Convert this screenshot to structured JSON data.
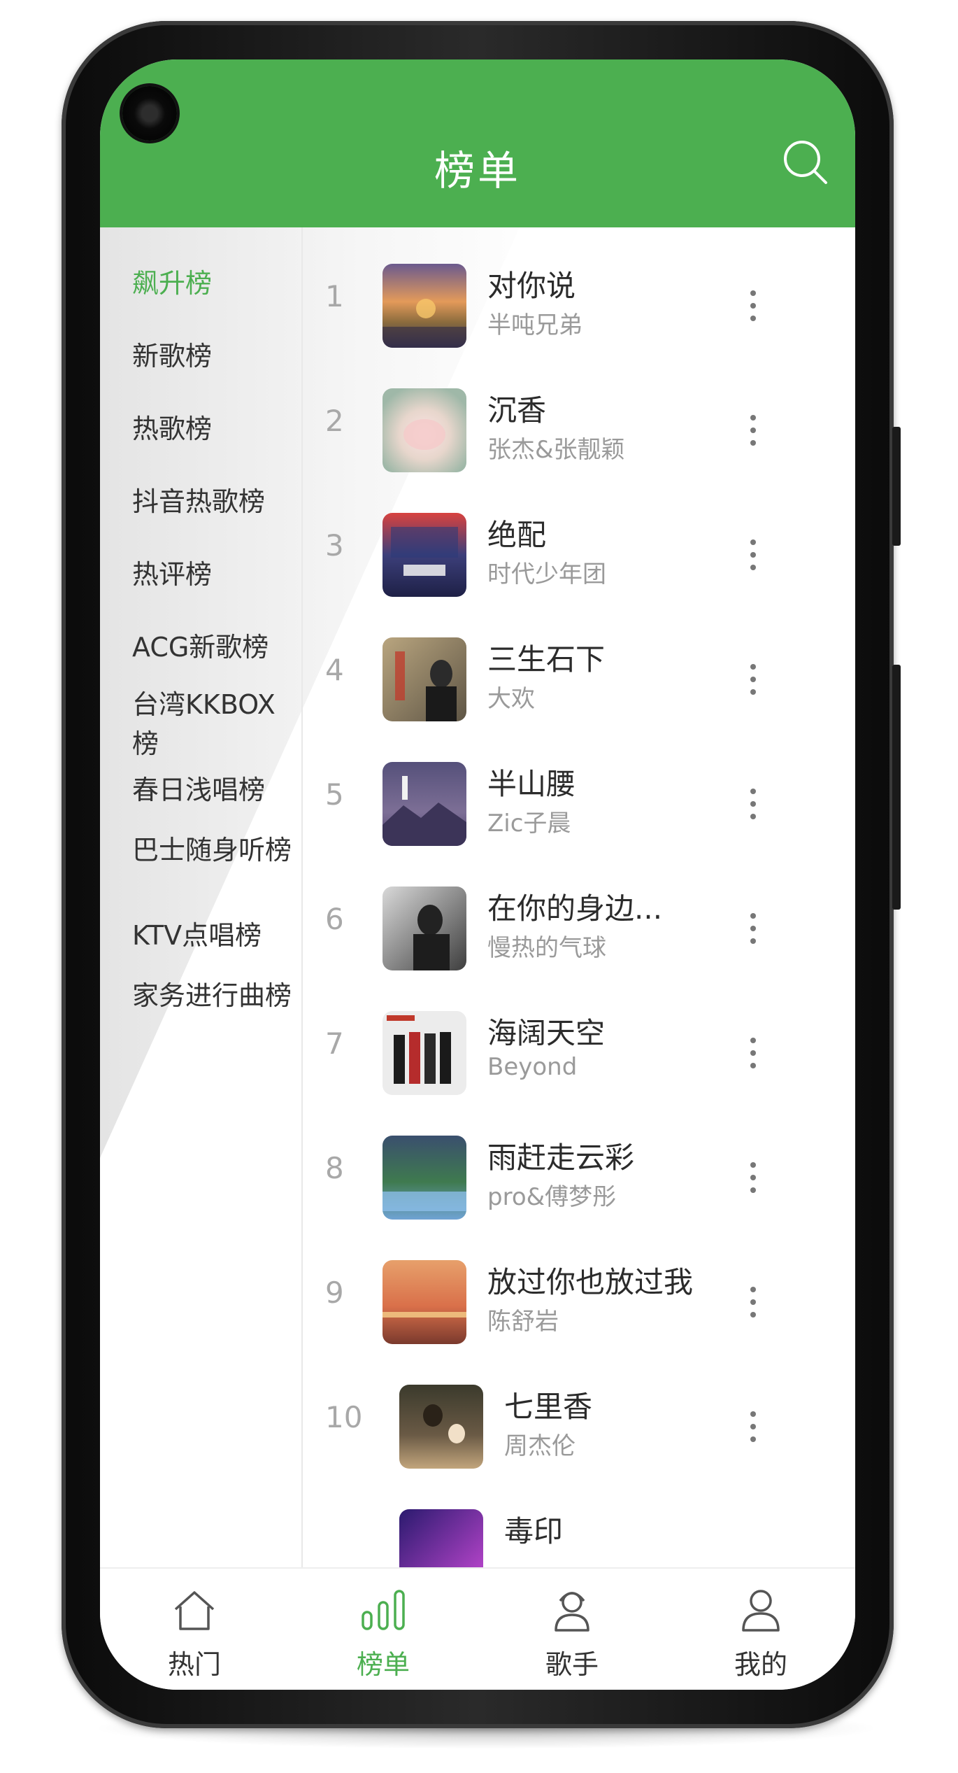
{
  "colors": {
    "accent": "#4CAF50",
    "text_primary": "#2b2b2b",
    "text_secondary": "#9a9a9a"
  },
  "header": {
    "title": "榜单",
    "search_icon": "search-icon"
  },
  "sidebar": {
    "categories": [
      {
        "label": "飙升榜",
        "active": true
      },
      {
        "label": "新歌榜"
      },
      {
        "label": "热歌榜"
      },
      {
        "label": "抖音热歌榜"
      },
      {
        "label": "热评榜"
      },
      {
        "label": "ACG新歌榜"
      },
      {
        "label": "台湾KKBOX榜"
      },
      {
        "label": "春日浅唱榜"
      },
      {
        "label": "巴士随身听榜"
      },
      {
        "label": "KTV点唱榜"
      },
      {
        "label": "家务进行曲榜"
      }
    ]
  },
  "songs": [
    {
      "rank": "1",
      "title": "对你说",
      "artist": "半吨兄弟"
    },
    {
      "rank": "2",
      "title": "沉香",
      "artist": "张杰&张靓颖"
    },
    {
      "rank": "3",
      "title": "绝配",
      "artist": "时代少年团"
    },
    {
      "rank": "4",
      "title": "三生石下",
      "artist": "大欢"
    },
    {
      "rank": "5",
      "title": "半山腰",
      "artist": "Zic子晨"
    },
    {
      "rank": "6",
      "title": "在你的身边...",
      "artist": "慢热的气球"
    },
    {
      "rank": "7",
      "title": "海阔天空",
      "artist": "Beyond"
    },
    {
      "rank": "8",
      "title": "雨赶走云彩",
      "artist": "pro&傅梦彤"
    },
    {
      "rank": "9",
      "title": "放过你也放过我",
      "artist": "陈舒岩"
    },
    {
      "rank": "10",
      "title": "七里香",
      "artist": "周杰伦"
    },
    {
      "rank": "",
      "title": "毒印",
      "artist": ""
    }
  ],
  "bottom_nav": [
    {
      "label": "热门",
      "icon": "home-icon"
    },
    {
      "label": "榜单",
      "icon": "chart-bars-icon",
      "active": true
    },
    {
      "label": "歌手",
      "icon": "singer-icon"
    },
    {
      "label": "我的",
      "icon": "profile-icon"
    }
  ]
}
